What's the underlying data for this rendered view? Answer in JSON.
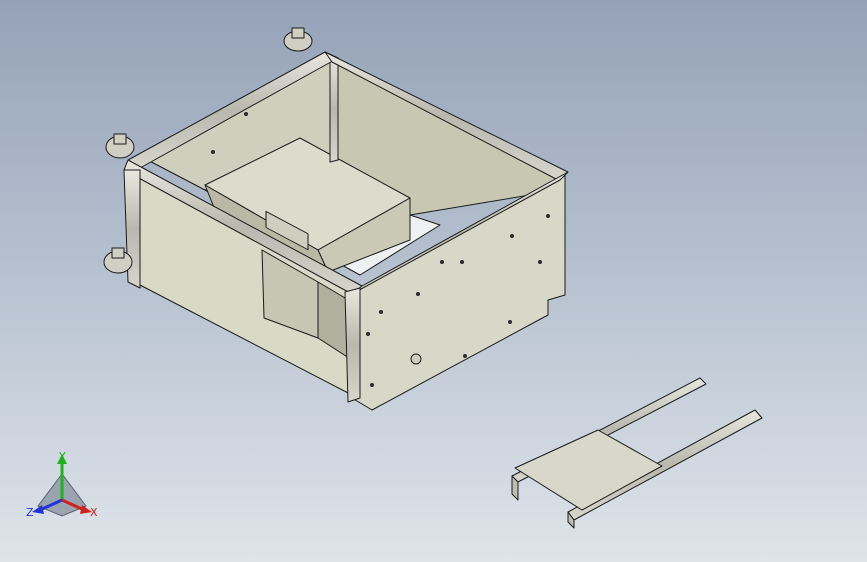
{
  "viewport": {
    "background_top": "#95a2b8",
    "background_bottom": "#dfe4ea"
  },
  "triad": {
    "x_label": "X",
    "y_label": "Y",
    "z_label": "Z",
    "x_color": "#d02020",
    "y_color": "#1fb21f",
    "z_color": "#2233d8"
  },
  "model": {
    "frame_color": "#c9c9be",
    "panel_color": "#d9d9c7",
    "edge_color": "#1a1a1a",
    "foot_icons": [
      "leveling-foot-icon",
      "leveling-foot-icon",
      "leveling-foot-icon"
    ]
  }
}
